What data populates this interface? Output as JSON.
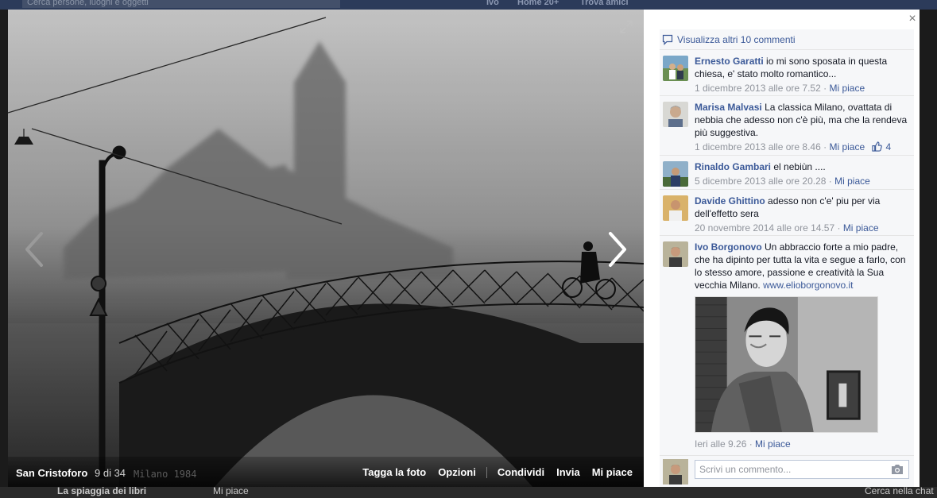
{
  "background": {
    "search_placeholder": "Cerca persone, luoghi e oggetti",
    "nav": [
      "Ivo",
      "Home 20+",
      "Trova amici"
    ],
    "bottom_left": "La spiaggia dei libri",
    "bottom_like": "Mi piace",
    "bottom_right": "Cerca nella chat"
  },
  "photo": {
    "title": "San Cristoforo",
    "counter": "9 di 34",
    "watermark_text": "Milano 1984",
    "actions": {
      "tag": "Tagga la foto",
      "options": "Opzioni",
      "share": "Condividi",
      "send": "Invia",
      "like": "Mi piace"
    }
  },
  "sidebar": {
    "close": "×",
    "view_more": "Visualizza altri 10 commenti",
    "comments": [
      {
        "author": "Ernesto Garatti",
        "text": "io mi sono sposata in questa chiesa, e' stato molto romantico...",
        "time": "1 dicembre 2013 alle ore 7.52",
        "like_label": "Mi piace",
        "likes": ""
      },
      {
        "author": "Marisa Malvasi",
        "text": "La classica Milano, ovattata di nebbia che adesso non c'è più, ma che la rendeva più suggestiva.",
        "time": "1 dicembre 2013 alle ore 8.46",
        "like_label": "Mi piace",
        "likes": "4"
      },
      {
        "author": "Rinaldo Gambari",
        "text": "el nebiùn ....",
        "time": "5 dicembre 2013 alle ore 20.28",
        "like_label": "Mi piace",
        "likes": ""
      },
      {
        "author": "Davide Ghittino",
        "text": "adesso non c'e' piu per via dell'effetto sera",
        "time": "20 novembre 2014 alle ore 14.57",
        "like_label": "Mi piace",
        "likes": ""
      },
      {
        "author": "Ivo Borgonovo",
        "text": "Un abbraccio forte a mio padre, che ha dipinto per tutta la vita e segue a farlo, con lo stesso amore, passione e creatività la Sua vecchia Milano.",
        "link": "www.elioborgonovo.it",
        "time": "Ieri alle 9.26",
        "like_label": "Mi piace",
        "likes": ""
      }
    ],
    "write_placeholder": "Scrivi un commento..."
  },
  "colors": {
    "link": "#3b5998",
    "meta": "#90949c",
    "panel": "#f6f7f9"
  }
}
